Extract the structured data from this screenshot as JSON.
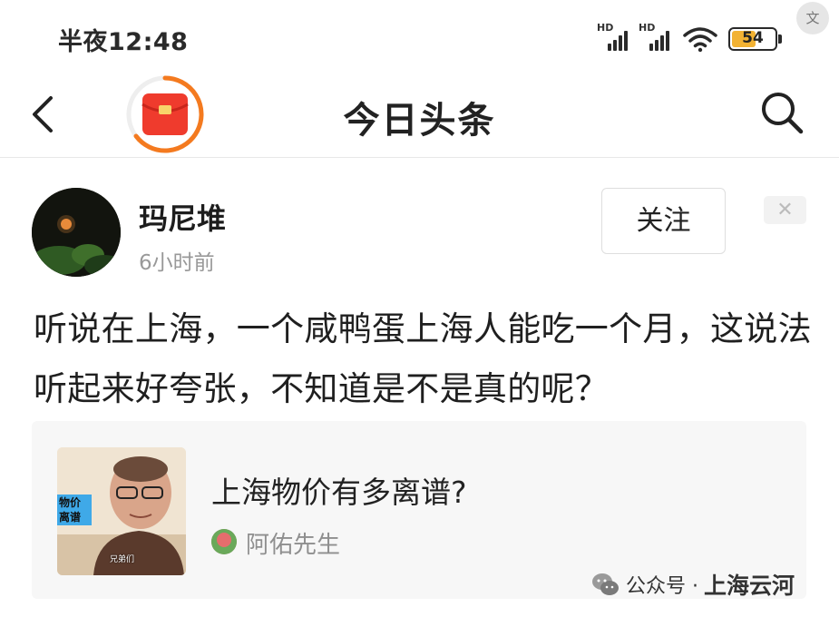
{
  "status_bar": {
    "time": "半夜12:48",
    "signal_badge": "HD",
    "battery_level": "54",
    "battery_color": "#f2b233",
    "translate_icon_label": "文"
  },
  "header": {
    "title": "今日头条",
    "back_icon": "chevron-left-icon",
    "search_icon": "search-icon",
    "redpack_icon": "red-envelope-icon",
    "accent": "#f47a1f"
  },
  "post": {
    "author_name": "玛尼堆",
    "time": "6小时前",
    "follow_label": "关注",
    "close_label": "✕",
    "text": "听说在上海，一个咸鸭蛋上海人能吃一个月，这说法听起来好夸张，不知道是不是真的呢？"
  },
  "card": {
    "title": "上海物价有多离谱?",
    "author": "阿佑先生",
    "thumb_tag": "物价 离谱",
    "thumb_caption": "兄弟们"
  },
  "watermark": {
    "text": "公众号 · ",
    "brand": "上海云河"
  }
}
